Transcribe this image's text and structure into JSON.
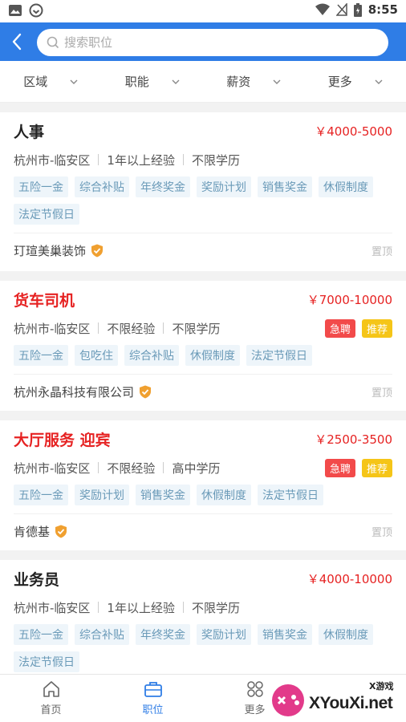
{
  "status_bar": {
    "time": "8:55"
  },
  "search": {
    "placeholder": "搜索职位"
  },
  "filters": [
    {
      "label": "区域"
    },
    {
      "label": "职能"
    },
    {
      "label": "薪资"
    },
    {
      "label": "更多"
    }
  ],
  "jobs": [
    {
      "title": "人事",
      "salary": "￥4000-5000",
      "location": "杭州市-临安区",
      "experience": "1年以上经验",
      "education": "不限学历",
      "tags": [
        "五险一金",
        "综合补贴",
        "年终奖金",
        "奖励计划",
        "销售奖金",
        "休假制度",
        "法定节假日"
      ],
      "company": "玎瑄美巢装饰",
      "pin_label": "置顶"
    },
    {
      "title": "货车司机",
      "salary": "￥7000-10000",
      "location": "杭州市-临安区",
      "experience": "不限经验",
      "education": "不限学历",
      "badge_urgent": "急聘",
      "badge_recommend": "推荐",
      "tags": [
        "五险一金",
        "包吃住",
        "综合补贴",
        "休假制度",
        "法定节假日"
      ],
      "company": "杭州永晶科技有限公司",
      "pin_label": "置顶"
    },
    {
      "title": "大厅服务 迎宾",
      "salary": "￥2500-3500",
      "location": "杭州市-临安区",
      "experience": "不限经验",
      "education": "高中学历",
      "badge_urgent": "急聘",
      "badge_recommend": "推荐",
      "tags": [
        "五险一金",
        "奖励计划",
        "销售奖金",
        "休假制度",
        "法定节假日"
      ],
      "company": "肯德基",
      "pin_label": "置顶"
    },
    {
      "title": "业务员",
      "salary": "￥4000-10000",
      "location": "杭州市-临安区",
      "experience": "1年以上经验",
      "education": "不限学历",
      "tags": [
        "五险一金",
        "综合补贴",
        "年终奖金",
        "奖励计划",
        "销售奖金",
        "休假制度",
        "法定节假日"
      ]
    }
  ],
  "bottom_nav": [
    {
      "label": "首页",
      "icon": "home-icon"
    },
    {
      "label": "职位",
      "icon": "briefcase-icon"
    },
    {
      "label": "更多",
      "icon": "grid-icon"
    }
  ],
  "watermark": {
    "text": "XYouXi.net",
    "small": "X游戏"
  },
  "colors": {
    "primary": "#2f7de6",
    "salary": "#e62222",
    "urgent": "#f24a4a",
    "recommend": "#f5c518",
    "tag_text": "#6a9ab8"
  }
}
